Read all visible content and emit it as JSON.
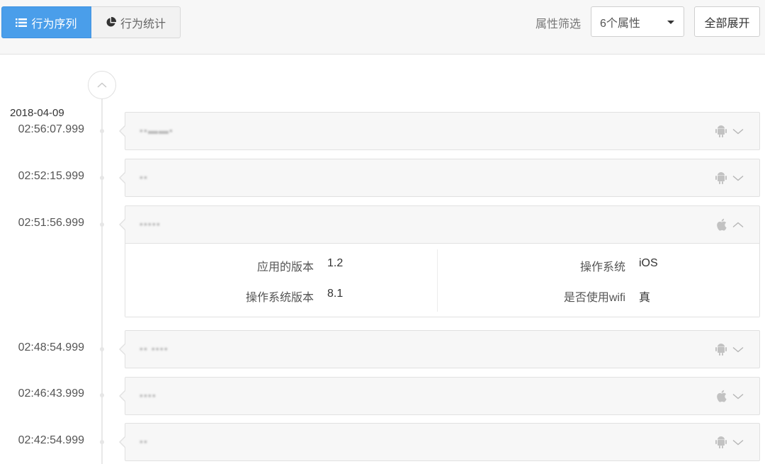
{
  "toolbar": {
    "tab_sequence": "行为序列",
    "tab_stats": "行为统计",
    "filter_label": "属性筛选",
    "filter_value": "6个属性",
    "expand_all": "全部展开"
  },
  "colors": {
    "accent": "#4a9eea",
    "icon_gray": "#c2c2c2"
  },
  "timeline": {
    "date": "2018-04-09",
    "events": [
      {
        "time": "02:56:07.999",
        "name": "▪▪▬▬▪",
        "os_icon": "android-icon",
        "expanded": false
      },
      {
        "time": "02:52:15.999",
        "name": "▪▪",
        "os_icon": "android-icon",
        "expanded": false
      },
      {
        "time": "02:51:56.999",
        "name": "▪▪▪▪▪",
        "os_icon": "apple-icon",
        "expanded": true,
        "details": {
          "app_version_key": "应用的版本",
          "app_version_val": "1.2",
          "os_key": "操作系统",
          "os_val": "iOS",
          "os_version_key": "操作系统版本",
          "os_version_val": "8.1",
          "wifi_key": "是否使用wifi",
          "wifi_val": "真"
        }
      },
      {
        "time": "02:48:54.999",
        "name": "▪▪ ▪▪▪▪",
        "os_icon": "android-icon",
        "expanded": false
      },
      {
        "time": "02:46:43.999",
        "name": "▪▪▪▪",
        "os_icon": "apple-icon",
        "expanded": false
      },
      {
        "time": "02:42:54.999",
        "name": "▪▪",
        "os_icon": "android-icon",
        "expanded": false
      }
    ]
  }
}
